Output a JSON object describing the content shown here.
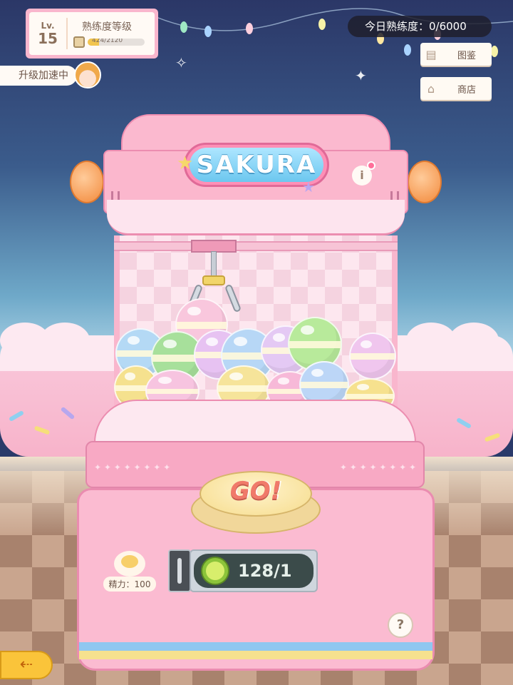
{
  "hud": {
    "level_label": "Lv.",
    "level_value": "15",
    "proficiency_title": "熟练度等级",
    "proficiency_progress_text": "424/2120",
    "proficiency_fraction": 0.2,
    "boost_text": "升级加速中",
    "daily_text": "今日熟练度：0/6000"
  },
  "side_menu": {
    "catalog_label": "图鉴",
    "shop_label": "商店"
  },
  "machine": {
    "sign_text": "SAKURA",
    "go_label": "GO!",
    "stamina_text": "精力：100",
    "coin_text": "128/1",
    "help_label": "?",
    "info_label": "i"
  },
  "icons": {
    "catalog": "book-icon",
    "shop": "shop-icon",
    "back": "back-arrow-icon"
  },
  "colors": {
    "machine_pink": "#fbb9cf",
    "sign_blue": "#6cc7ef",
    "go_text": "#f07a6a",
    "back_button": "#fac43a"
  }
}
